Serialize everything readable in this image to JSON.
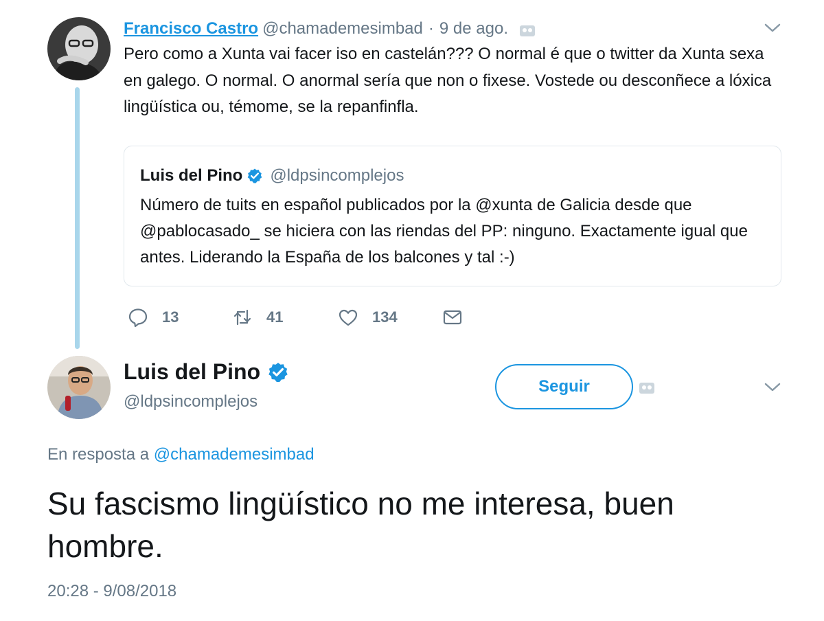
{
  "parent_tweet": {
    "author_name": "Francisco Castro",
    "author_handle": "@chamademesimbad",
    "separator": "·",
    "date": "9 de ago.",
    "text": "Pero como a Xunta vai facer iso en castelán??? O normal é que o twitter da Xunta sexa en galego. O normal. O anormal sería que non o fixese. Vostede ou desconñece a lóxica lingüística ou, témome, se la repanfinfla.",
    "quoted_tweet": {
      "author_name": "Luis del Pino",
      "author_handle": "@ldpsincomplejos",
      "text": "Número de tuits en español publicados por la @xunta de Galicia desde que @pablocasado_ se hiciera con las riendas del PP: ninguno. Exactamente igual que antes. Liderando la España de los balcones y tal :-)"
    },
    "actions": {
      "reply_count": "13",
      "retweet_count": "41",
      "like_count": "134"
    }
  },
  "main_tweet": {
    "author_name": "Luis del Pino",
    "author_handle": "@ldpsincomplejos",
    "follow_label": "Seguir",
    "reply_prefix": "En resposta a",
    "reply_mention": "@chamademesimbad",
    "text": "Su fascismo lingüístico no me interesa, buen hombre.",
    "timestamp": "20:28 - 9/08/2018"
  },
  "colors": {
    "accent": "#1b95e0",
    "secondary_text": "#657786",
    "thread_line": "#a9d6eb",
    "border": "#e1e8ed"
  },
  "icons": [
    "reply-icon",
    "retweet-icon",
    "like-icon",
    "message-icon",
    "verified-icon",
    "chevron-down-icon",
    "translate-icon"
  ]
}
